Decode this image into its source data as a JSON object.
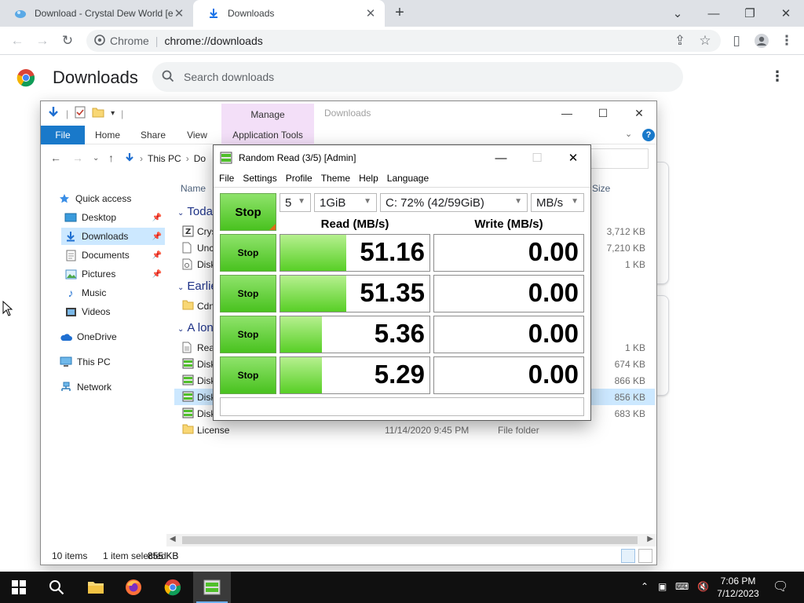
{
  "chrome": {
    "tabs": [
      {
        "title": "Download - Crystal Dew World [e",
        "icon": "crystal-dew-favicon"
      },
      {
        "title": "Downloads",
        "icon": "download-icon"
      }
    ],
    "new_tab_label": "+",
    "site_chip": "Chrome",
    "url": "chrome://downloads",
    "page_title": "Downloads",
    "search_placeholder": "Search downloads"
  },
  "explorer": {
    "title": "Downloads",
    "manage_tab": "Manage",
    "ribbon_tabs": {
      "file": "File",
      "home": "Home",
      "share": "Share",
      "view": "View",
      "app_tools": "Application Tools"
    },
    "breadcrumb": {
      "root": "This PC",
      "current": "Do"
    },
    "nav": {
      "quick_access": "Quick access",
      "desktop": "Desktop",
      "downloads": "Downloads",
      "documents": "Documents",
      "pictures": "Pictures",
      "music": "Music",
      "videos": "Videos",
      "onedrive": "OneDrive",
      "this_pc": "This PC",
      "network": "Network"
    },
    "columns": {
      "name": "Name",
      "size": "Size"
    },
    "groups": {
      "today": "Today",
      "earlier": "Earlie",
      "long_ago": "A long"
    },
    "rows": [
      {
        "name": "Crys",
        "size": "3,712 KB"
      },
      {
        "name": "Unc",
        "size": "7,210 KB"
      },
      {
        "name": "Disk",
        "size": "1 KB"
      },
      {
        "name": "Cdn",
        "size": ""
      },
      {
        "name": "Rea",
        "size": "1 KB"
      },
      {
        "name": "Disk",
        "size": "674 KB"
      },
      {
        "name": "Disk",
        "size": "866 KB"
      },
      {
        "name": "Disk",
        "size": "856 KB"
      },
      {
        "name": "Disk",
        "size": "683 KB"
      },
      {
        "name": "License",
        "date": "11/14/2020 9:45 PM",
        "type": "File folder",
        "size": ""
      }
    ],
    "status": {
      "count": "10 items",
      "selection": "1 item selected",
      "selection_size": "855 KB"
    }
  },
  "cdm": {
    "title": "Random Read (3/5) [Admin]",
    "menu": {
      "file": "File",
      "settings": "Settings",
      "profile": "Profile",
      "theme": "Theme",
      "help": "Help",
      "language": "Language"
    },
    "all_button": "Stop",
    "count": "5",
    "size": "1GiB",
    "drive": "C: 72% (42/59GiB)",
    "unit": "MB/s",
    "read_header": "Read (MB/s)",
    "write_header": "Write (MB/s)",
    "tests": [
      {
        "button": "Stop",
        "read": "51.16",
        "write": "0.00",
        "read_level": 0.44
      },
      {
        "button": "Stop",
        "read": "51.35",
        "write": "0.00",
        "read_level": 0.44
      },
      {
        "button": "Stop",
        "read": "5.36",
        "write": "0.00",
        "read_level": 0.28
      },
      {
        "button": "Stop",
        "read": "5.29",
        "write": "0.00",
        "read_level": 0.28
      }
    ]
  },
  "taskbar": {
    "time": "7:06 PM",
    "date": "7/12/2023"
  }
}
